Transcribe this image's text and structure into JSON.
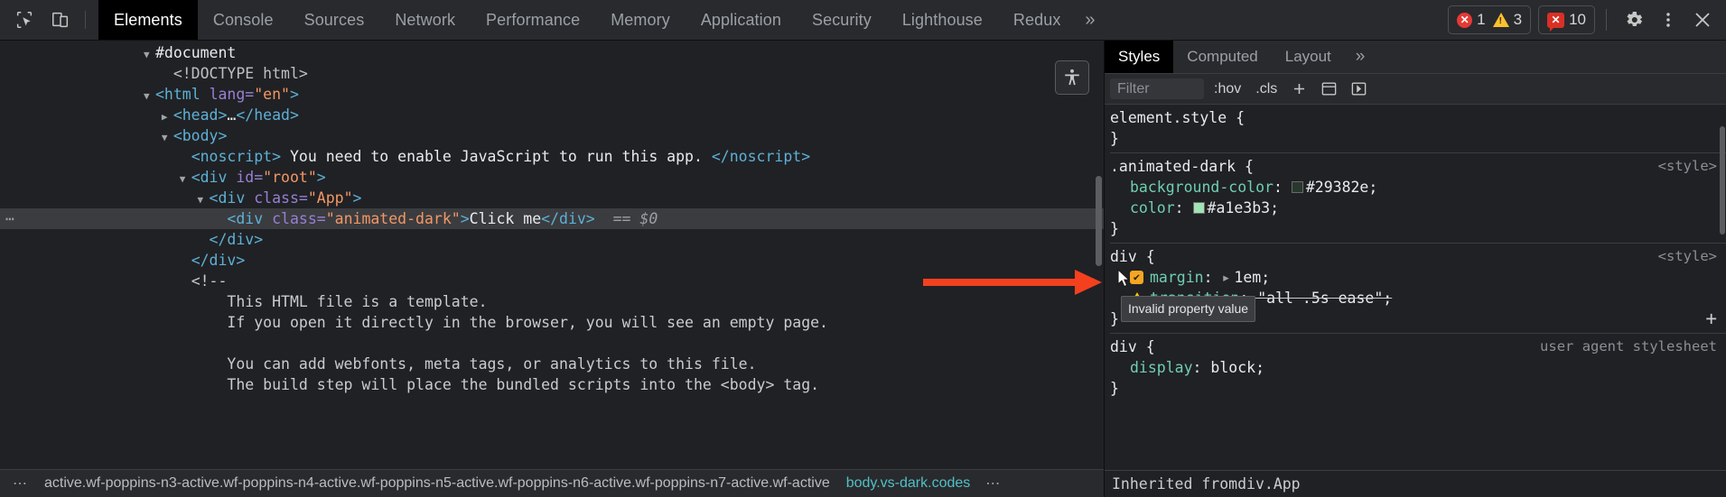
{
  "toolbar": {
    "icons": [
      {
        "name": "inspect-element-icon",
        "title": "Inspect"
      },
      {
        "name": "device-toolbar-icon",
        "title": "Toggle device toolbar"
      }
    ],
    "tabs": [
      {
        "label": "Elements",
        "active": true
      },
      {
        "label": "Console",
        "active": false
      },
      {
        "label": "Sources",
        "active": false
      },
      {
        "label": "Network",
        "active": false
      },
      {
        "label": "Performance",
        "active": false
      },
      {
        "label": "Memory",
        "active": false
      },
      {
        "label": "Application",
        "active": false
      },
      {
        "label": "Security",
        "active": false
      },
      {
        "label": "Lighthouse",
        "active": false
      },
      {
        "label": "Redux",
        "active": false
      }
    ],
    "more_label": "»",
    "badges": {
      "error_count": "1",
      "warning_count": "3",
      "message_count": "10",
      "error_glyph": "✕",
      "message_glyph": "✕"
    },
    "settings_label": "gear-icon",
    "menu_label": "⋮",
    "close_label": "✕"
  },
  "dom": {
    "lines": [
      {
        "indent": 8,
        "arrow": "down",
        "parts": [
          {
            "cls": "tx",
            "t": "#document"
          }
        ]
      },
      {
        "indent": 9,
        "arrow": "",
        "parts": [
          {
            "cls": "dt",
            "t": "<!DOCTYPE html>"
          }
        ]
      },
      {
        "indent": 8,
        "arrow": "down",
        "parts": [
          {
            "cls": "tw",
            "t": "<html "
          },
          {
            "cls": "at",
            "t": "lang="
          },
          {
            "cls": "av",
            "t": "\"en\""
          },
          {
            "cls": "tw",
            "t": ">"
          }
        ]
      },
      {
        "indent": 9,
        "arrow": "right",
        "parts": [
          {
            "cls": "tw",
            "t": "<head>"
          },
          {
            "cls": "tx",
            "t": "…"
          },
          {
            "cls": "tw",
            "t": "</head>"
          }
        ]
      },
      {
        "indent": 9,
        "arrow": "down",
        "parts": [
          {
            "cls": "tw",
            "t": "<body>"
          }
        ]
      },
      {
        "indent": 10,
        "arrow": "",
        "parts": [
          {
            "cls": "tw",
            "t": "<noscript>"
          },
          {
            "cls": "tx",
            "t": " You need to enable JavaScript to run this app. "
          },
          {
            "cls": "tw",
            "t": "</noscript>"
          }
        ]
      },
      {
        "indent": 10,
        "arrow": "down",
        "parts": [
          {
            "cls": "tw",
            "t": "<div "
          },
          {
            "cls": "at",
            "t": "id="
          },
          {
            "cls": "av",
            "t": "\"root\""
          },
          {
            "cls": "tw",
            "t": ">"
          }
        ]
      },
      {
        "indent": 11,
        "arrow": "down",
        "parts": [
          {
            "cls": "tw",
            "t": "<div "
          },
          {
            "cls": "at",
            "t": "class="
          },
          {
            "cls": "av",
            "t": "\"App\""
          },
          {
            "cls": "tw",
            "t": ">"
          }
        ]
      },
      {
        "indent": 12,
        "arrow": "",
        "selected": true,
        "parts": [
          {
            "cls": "tw",
            "t": "<div "
          },
          {
            "cls": "at",
            "t": "class="
          },
          {
            "cls": "av",
            "t": "\"animated-dark\""
          },
          {
            "cls": "tw",
            "t": ">"
          },
          {
            "cls": "tx",
            "t": "Click me"
          },
          {
            "cls": "tw",
            "t": "</div>"
          },
          {
            "cls": "rf",
            "t": "  == $0"
          }
        ]
      },
      {
        "indent": 11,
        "arrow": "",
        "parts": [
          {
            "cls": "tw",
            "t": "</div>"
          }
        ]
      },
      {
        "indent": 10,
        "arrow": "",
        "parts": [
          {
            "cls": "tw",
            "t": "</div>"
          }
        ]
      },
      {
        "indent": 10,
        "arrow": "",
        "parts": [
          {
            "cls": "cm",
            "t": "<!--"
          }
        ]
      },
      {
        "indent": 12,
        "arrow": "",
        "parts": [
          {
            "cls": "cm",
            "t": "This HTML file is a template."
          }
        ]
      },
      {
        "indent": 12,
        "arrow": "",
        "parts": [
          {
            "cls": "cm",
            "t": "If you open it directly in the browser, you will see an empty page."
          }
        ]
      },
      {
        "indent": 12,
        "arrow": "",
        "parts": [
          {
            "cls": "cm",
            "t": ""
          }
        ]
      },
      {
        "indent": 12,
        "arrow": "",
        "parts": [
          {
            "cls": "cm",
            "t": "You can add webfonts, meta tags, or analytics to this file."
          }
        ]
      },
      {
        "indent": 12,
        "arrow": "",
        "parts": [
          {
            "cls": "cm",
            "t": "The build step will place the bundled scripts into the <body> tag."
          }
        ]
      }
    ],
    "selected_handle": "⋯",
    "a11y_button": "accessibility-icon"
  },
  "breadcrumbs": {
    "overflow_label": "⋯",
    "items": [
      {
        "label": "active.wf-poppins-n3-active.wf-poppins-n4-active.wf-poppins-n5-active.wf-poppins-n6-active.wf-poppins-n7-active.wf-active",
        "current": false
      },
      {
        "label": "body.vs-dark.codes",
        "current": true
      }
    ],
    "trailing_ellipsis": "⋯"
  },
  "styles": {
    "tabs": [
      {
        "label": "Styles",
        "active": true
      },
      {
        "label": "Computed",
        "active": false
      },
      {
        "label": "Layout",
        "active": false
      }
    ],
    "more_label": "»",
    "filter": {
      "placeholder": "Filter",
      "value": ""
    },
    "toggles": [
      {
        "label": ":hov"
      },
      {
        "label": ".cls"
      }
    ],
    "new_rule_label": "+",
    "rules": [
      {
        "selector": "element.style {",
        "close": "}",
        "origin": "",
        "declarations": []
      },
      {
        "selector": ".animated-dark {",
        "close": "}",
        "origin": "<style>",
        "declarations": [
          {
            "prop": "background-color",
            "value": "#29382e;",
            "swatch": "#29382e",
            "state": "normal"
          },
          {
            "prop": "color",
            "value": "#a1e3b3;",
            "swatch": "#a1e3b3",
            "state": "normal"
          }
        ]
      },
      {
        "selector": "div {",
        "close": "}",
        "origin": "<style>",
        "declarations": [
          {
            "prop": "margin",
            "value": "1em;",
            "expand": "▸",
            "state": "checked"
          },
          {
            "prop": "transition",
            "value": "\"all .5s ease\";",
            "state": "invalid"
          }
        ]
      },
      {
        "selector": "div {",
        "close": "}",
        "origin": "user agent stylesheet",
        "declarations": [
          {
            "prop": "display",
            "value": "block;",
            "state": "normal"
          }
        ]
      }
    ],
    "tooltip": "Invalid property value",
    "inherited_prefix": "Inherited from ",
    "inherited_target": "div.App"
  },
  "annotation": {
    "arrow_color": "#f4401f",
    "name": "red-pointer-arrow"
  }
}
